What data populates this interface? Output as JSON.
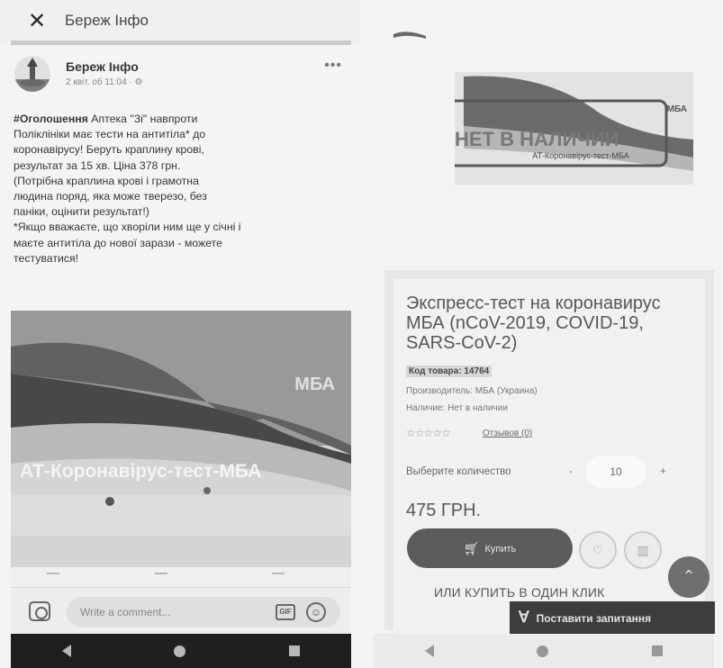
{
  "left": {
    "header": {
      "title": "Береж Інфо",
      "close_icon": "close-icon"
    },
    "post": {
      "author": "Береж Інфо",
      "meta": "2 квіт. об 11:04 · ⚙",
      "hashtag": "#Оголошення",
      "text": [
        " Аптека \"Зі\" навпроти",
        "Поліклініки має тести на антитіла* до",
        "коронавірусу! Беруть краплину крові,",
        "результат за 15 хв. Ціна 378 грн.",
        "(Потрібна краплина крові і грамотна",
        "людина поряд, яка може тверезо, без",
        "паніки, оцінити результат!)",
        "*Якщо вважаєте, що хворіли ним ще у січні і",
        "маєте антитіла до нової зарази - можете",
        "тестуватися!"
      ],
      "photo": {
        "brand": "МБА",
        "product_label": "АТ-Коронавірус-тест-МБА"
      }
    },
    "comment": {
      "placeholder": "Write a comment...",
      "gif_label": "GIF",
      "emoji": "☺"
    }
  },
  "right": {
    "product_image": {
      "stamp": "НЕТ В НАЛИЧИИ",
      "label": "АТ-Коронавірус-тест-МБА",
      "brand": "МБА"
    },
    "product": {
      "title": "Экспресс-тест на коронавирус МБА (nCoV-2019, COVID-19, SARS-CoV-2)",
      "code": "Код товара: 14764",
      "manufacturer": "Производитель: МБА (Украина)",
      "availability": "Наличие: Нет в наличии",
      "stars": "☆☆☆☆☆",
      "reviews": "Отзывов (0)",
      "quantity_label": "Выберите количество",
      "quantity_value": "10",
      "price": "475 ГРН.",
      "buy_label": "Купить",
      "one_click": "ИЛИ КУПИТЬ В ОДИН КЛИК"
    },
    "ask_question": "Поставити запитання",
    "scroll_top_icon": "chevron-up-icon"
  },
  "nav": {
    "back_icon": "back-icon",
    "home_icon": "home-icon",
    "recent_icon": "recent-apps-icon"
  }
}
